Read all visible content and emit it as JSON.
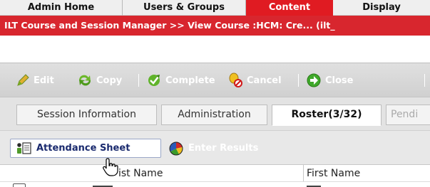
{
  "topnav": {
    "tabs": [
      {
        "label": "Admin Home"
      },
      {
        "label": "Users & Groups"
      },
      {
        "label": "Content"
      },
      {
        "label": "Display"
      }
    ]
  },
  "titlebar": {
    "text": "ILT Course and Session Manager >> View Course :HCM: Cre... (ilt_"
  },
  "toolbar": {
    "edit": "Edit",
    "copy": "Copy",
    "complete": "Complete",
    "cancel": "Cancel",
    "close": "Close",
    "separator": "|"
  },
  "subtabs": [
    {
      "label": "Session Information"
    },
    {
      "label": "Administration"
    },
    {
      "label": "Roster(3/32)"
    },
    {
      "label": "Pendi"
    }
  ],
  "actionbar": {
    "attendance": "Attendance Sheet",
    "enter_results": "Enter Results"
  },
  "grid": {
    "columns": [
      {
        "label": "ist Name"
      },
      {
        "label": "First Name"
      }
    ]
  },
  "colors": {
    "accent_red": "#e01b22",
    "title_red": "#d8262e",
    "link_blue": "#1a2a6e"
  }
}
